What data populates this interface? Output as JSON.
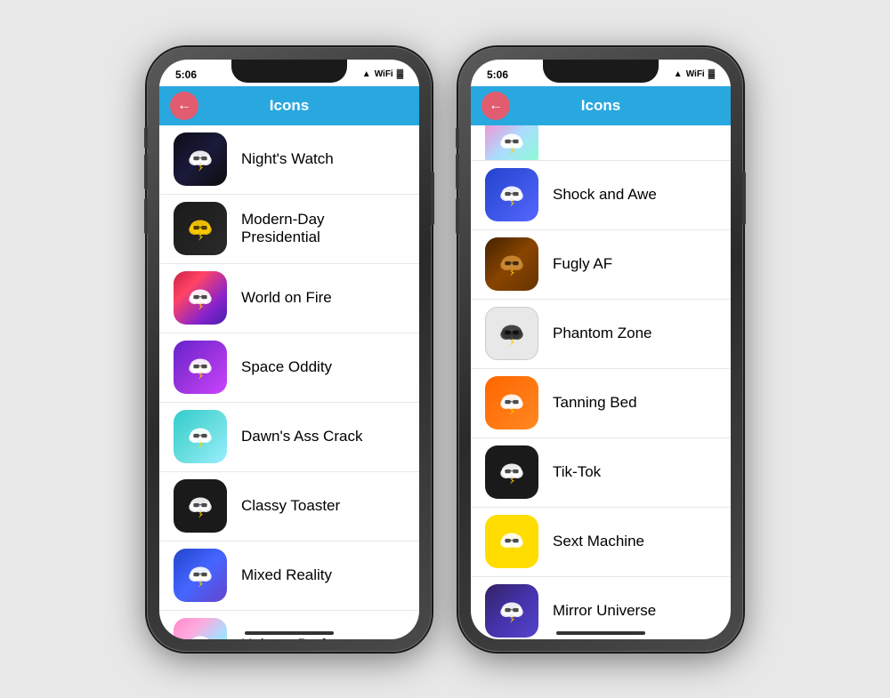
{
  "phone1": {
    "status": {
      "time": "5:06",
      "signals": "▲ ● ●"
    },
    "nav": {
      "title": "Icons",
      "back_label": "←"
    },
    "items": [
      {
        "id": "nights-watch",
        "label": "Night's Watch",
        "bg": "bg-nights-watch",
        "icon_color": "#fff"
      },
      {
        "id": "modern-day",
        "label": "Modern-Day Presidential",
        "bg": "bg-modern-day",
        "icon_color": "#ffcc00"
      },
      {
        "id": "world-fire",
        "label": "World on Fire",
        "bg": "bg-world-fire",
        "icon_color": "#fff"
      },
      {
        "id": "space-oddity",
        "label": "Space Oddity",
        "bg": "bg-space-oddity",
        "icon_color": "#fff"
      },
      {
        "id": "dawns-crack",
        "label": "Dawn's Ass Crack",
        "bg": "bg-dawns-crack",
        "icon_color": "#fff"
      },
      {
        "id": "classy-toaster",
        "label": "Classy Toaster",
        "bg": "bg-classy-toaster",
        "icon_color": "#fff"
      },
      {
        "id": "mixed-reality",
        "label": "Mixed Reality",
        "bg": "bg-mixed-reality",
        "icon_color": "#fff"
      },
      {
        "id": "unicorn-barf",
        "label": "Unicorn Barf",
        "bg": "bg-unicorn-barf",
        "icon_color": "#fff"
      }
    ]
  },
  "phone2": {
    "status": {
      "time": "5:06",
      "signals": "▲ ● ●"
    },
    "nav": {
      "title": "Icons",
      "back_label": "←"
    },
    "items": [
      {
        "id": "shock-awe",
        "label": "Shock and Awe",
        "bg": "bg-shock-awe",
        "icon_color": "#fff"
      },
      {
        "id": "fugly-af",
        "label": "Fugly AF",
        "bg": "bg-fugly-af",
        "icon_color": "#cc8833"
      },
      {
        "id": "phantom-zone",
        "label": "Phantom Zone",
        "bg": "bg-phantom-zone",
        "icon_color": "#333"
      },
      {
        "id": "tanning-bed",
        "label": "Tanning Bed",
        "bg": "bg-tanning-bed",
        "icon_color": "#fff"
      },
      {
        "id": "tik-tok",
        "label": "Tik-Tok",
        "bg": "bg-tik-tok",
        "icon_color": "#fff"
      },
      {
        "id": "sext-machine",
        "label": "Sext Machine",
        "bg": "bg-sext-machine",
        "icon_color": "#fff"
      },
      {
        "id": "mirror-universe",
        "label": "Mirror Universe",
        "bg": "bg-mirror-universe",
        "icon_color": "#fff"
      }
    ]
  }
}
